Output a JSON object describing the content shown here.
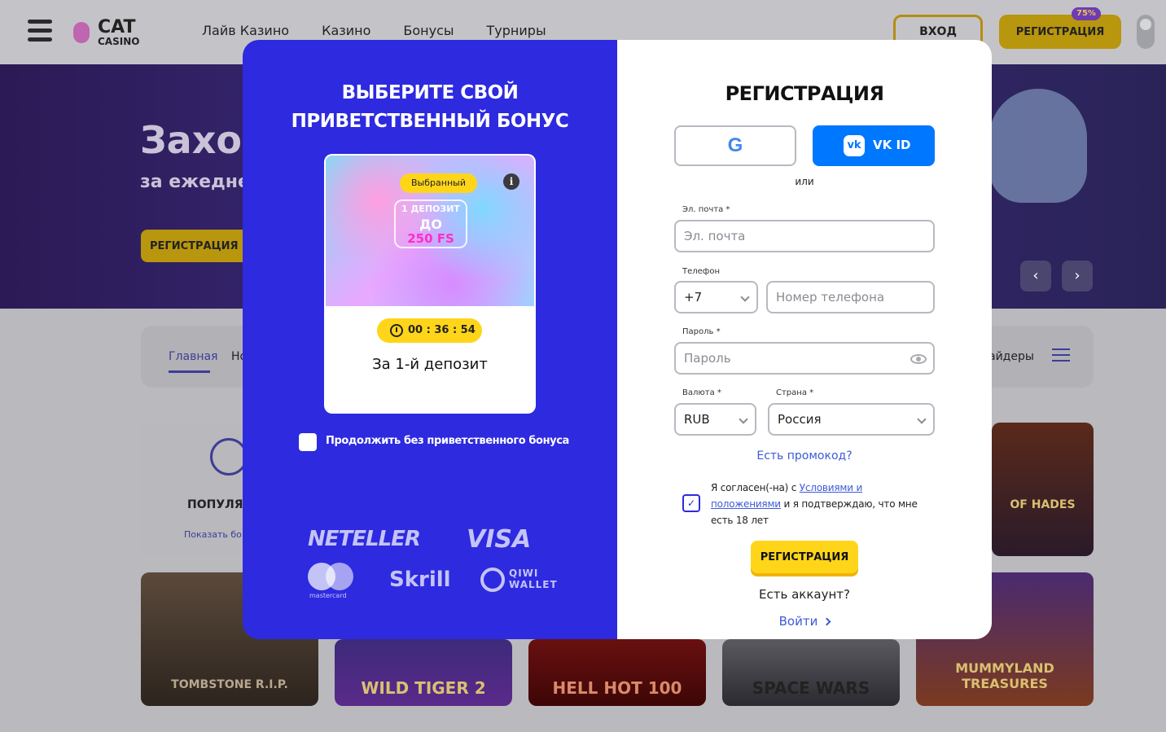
{
  "header": {
    "logo_main": "CAT",
    "logo_sub": "CASINO",
    "nav": [
      "Лайв Казино",
      "Казино",
      "Бонусы",
      "Турниры"
    ],
    "login_label": "ВХОД",
    "register_label": "РЕГИСТРАЦИЯ",
    "promo_badge": "75%"
  },
  "hero": {
    "title": "Заход",
    "subtitle": "за ежеднев",
    "register_label": "РЕГИСТРАЦИЯ",
    "prev": "‹",
    "next": "›"
  },
  "tabs": {
    "main": "Главная",
    "next": "Но",
    "providers": "айдеры"
  },
  "popular": {
    "title": "ПОПУЛЯР",
    "link": "Показать бо"
  },
  "games": [
    "TOMBSTONE R.I.P.",
    "WILD TIGER 2",
    "HELL HOT 100",
    "SPACE WARS",
    "MUMMYLAND TREASURES",
    "OF HADES"
  ],
  "bonus_panel": {
    "title_line1": "ВЫБЕРИТЕ СВОЙ",
    "title_line2": "ПРИВЕТСТВЕННЫЙ БОНУС",
    "selected_chip": "Выбранный",
    "info": "i",
    "deposit_label": "1 ДЕПОЗИТ",
    "deposit_to": "ДО",
    "deposit_fs": "250 FS",
    "timer": "00 : 36 : 54",
    "caption": "За 1-й депозит",
    "skip_label": "Продолжить без приветственного бонуса",
    "payments": {
      "neteller": "NETELLER",
      "visa": "VISA",
      "mastercard": "mastercard",
      "skrill": "Skrill",
      "qiwi_line1": "QIWI",
      "qiwi_line2": "WALLET"
    }
  },
  "register_form": {
    "title": "РЕГИСТРАЦИЯ",
    "vk_label": "VK ID",
    "or": "или",
    "email_label": "Эл. почта *",
    "email_placeholder": "Эл. почта",
    "phone_label": "Телефон",
    "phone_code": "+7",
    "phone_placeholder": "Номер телефона",
    "password_label": "Пароль *",
    "password_placeholder": "Пароль",
    "currency_label": "Валюта *",
    "currency_value": "RUB",
    "country_label": "Страна *",
    "country_value": "Россия",
    "promo_link": "Есть промокод?",
    "agree_prefix": "Я согласен(-на) с ",
    "agree_link": "Условиями и положениями",
    "agree_suffix": " и я подтверждаю, что мне есть 18 лет",
    "submit_label": "РЕГИСТРАЦИЯ",
    "have_account": "Есть аккаунт?",
    "login_link": "Войти"
  }
}
